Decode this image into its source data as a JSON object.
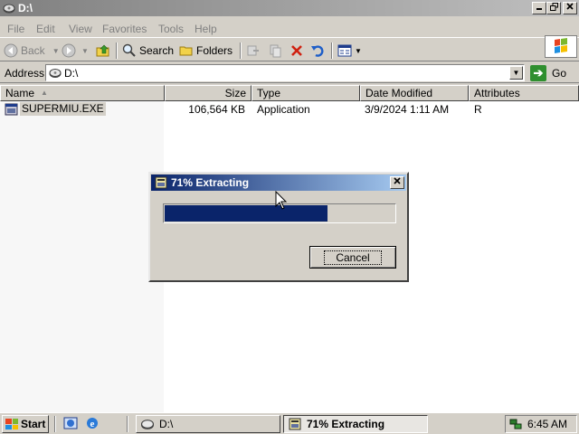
{
  "window": {
    "title": "D:\\",
    "menu": [
      "File",
      "Edit",
      "View",
      "Favorites",
      "Tools",
      "Help"
    ],
    "toolbar": {
      "back_label": "Back",
      "search_label": "Search",
      "folders_label": "Folders"
    },
    "address": {
      "label": "Address",
      "value": "D:\\",
      "go_label": "Go"
    },
    "columns": [
      "Name",
      "Size",
      "Type",
      "Date Modified",
      "Attributes"
    ],
    "files": [
      {
        "name": "SUPERMIU.EXE",
        "size": "106,564 KB",
        "type": "Application",
        "modified": "3/9/2024 1:11 AM",
        "attributes": "R"
      }
    ]
  },
  "dialog": {
    "title": "71% Extracting",
    "progress": 0.71,
    "cancel_label": "Cancel"
  },
  "taskbar": {
    "start_label": "Start",
    "tasks": [
      {
        "label": "D:\\",
        "active": false
      },
      {
        "label": "71% Extracting",
        "active": true
      }
    ],
    "clock": "6:45 AM"
  },
  "colors": {
    "title_active_start": "#0a246a",
    "title_active_end": "#a6caf0",
    "title_inactive_start": "#808080",
    "progress_fill": "#0a246a",
    "face": "#d4d0c8"
  }
}
